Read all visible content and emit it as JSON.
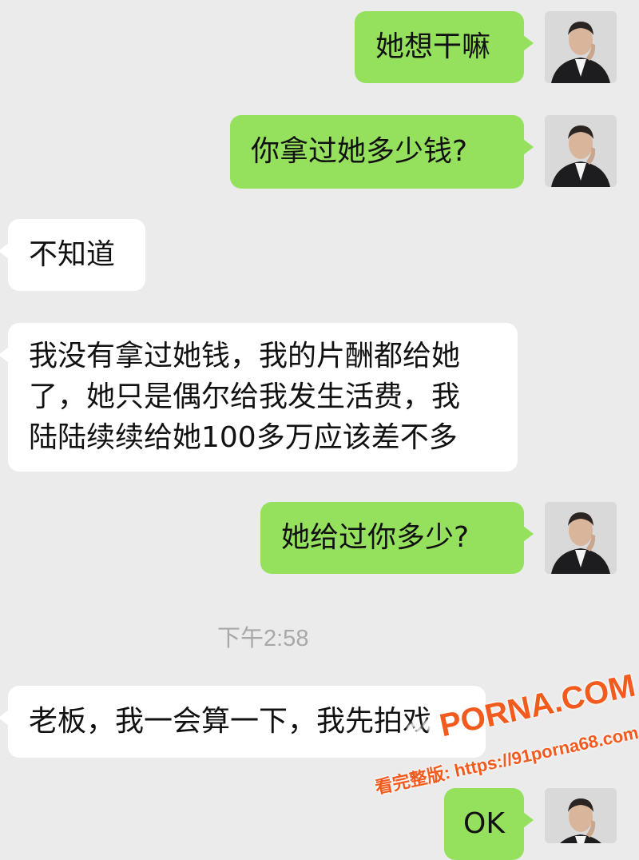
{
  "messages": [
    {
      "sender": "me",
      "text": "她想干嘛"
    },
    {
      "sender": "me",
      "text": "你拿过她多少钱?"
    },
    {
      "sender": "them",
      "text": "不知道"
    },
    {
      "sender": "them",
      "lines": [
        "我没有拿过她钱，我的片酬都给她",
        "了，她只是偶尔给我发生活费，我",
        "陆陆续续给她100多万应该差不多"
      ]
    },
    {
      "sender": "me",
      "text": "她给过你多少?"
    },
    {
      "sender": "them",
      "text": "老板，我一会算一下，我先拍戏"
    },
    {
      "sender": "me",
      "text": "OK"
    }
  ],
  "timestamp": "下午2:58",
  "watermark": {
    "prefix": "91",
    "logo": "PORNA.COM",
    "url_text": "看完整版: https://91porna68.com"
  },
  "colors": {
    "background": "#ebebeb",
    "sent_bubble": "#95e15e",
    "received_bubble": "#ffffff",
    "timestamp": "#a8a8a8",
    "watermark": "#f25a1e"
  },
  "icons": {
    "avatar": "user-avatar-photo"
  }
}
